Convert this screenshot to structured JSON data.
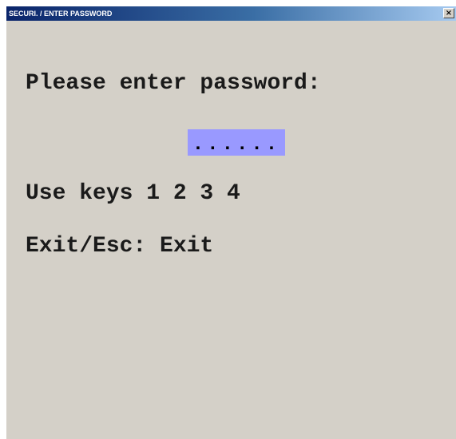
{
  "window": {
    "title": "SECURI. / ENTER PASSWORD",
    "close_label": "×"
  },
  "main": {
    "prompt": "Please enter password:",
    "password_mask": "......",
    "keys_hint": "Use keys 1 2 3 4",
    "exit_hint": "Exit/Esc: Exit"
  },
  "colors": {
    "window_background": "#d4d0c8",
    "password_field_background": "#9999ff",
    "titlebar": "#0a246a"
  }
}
